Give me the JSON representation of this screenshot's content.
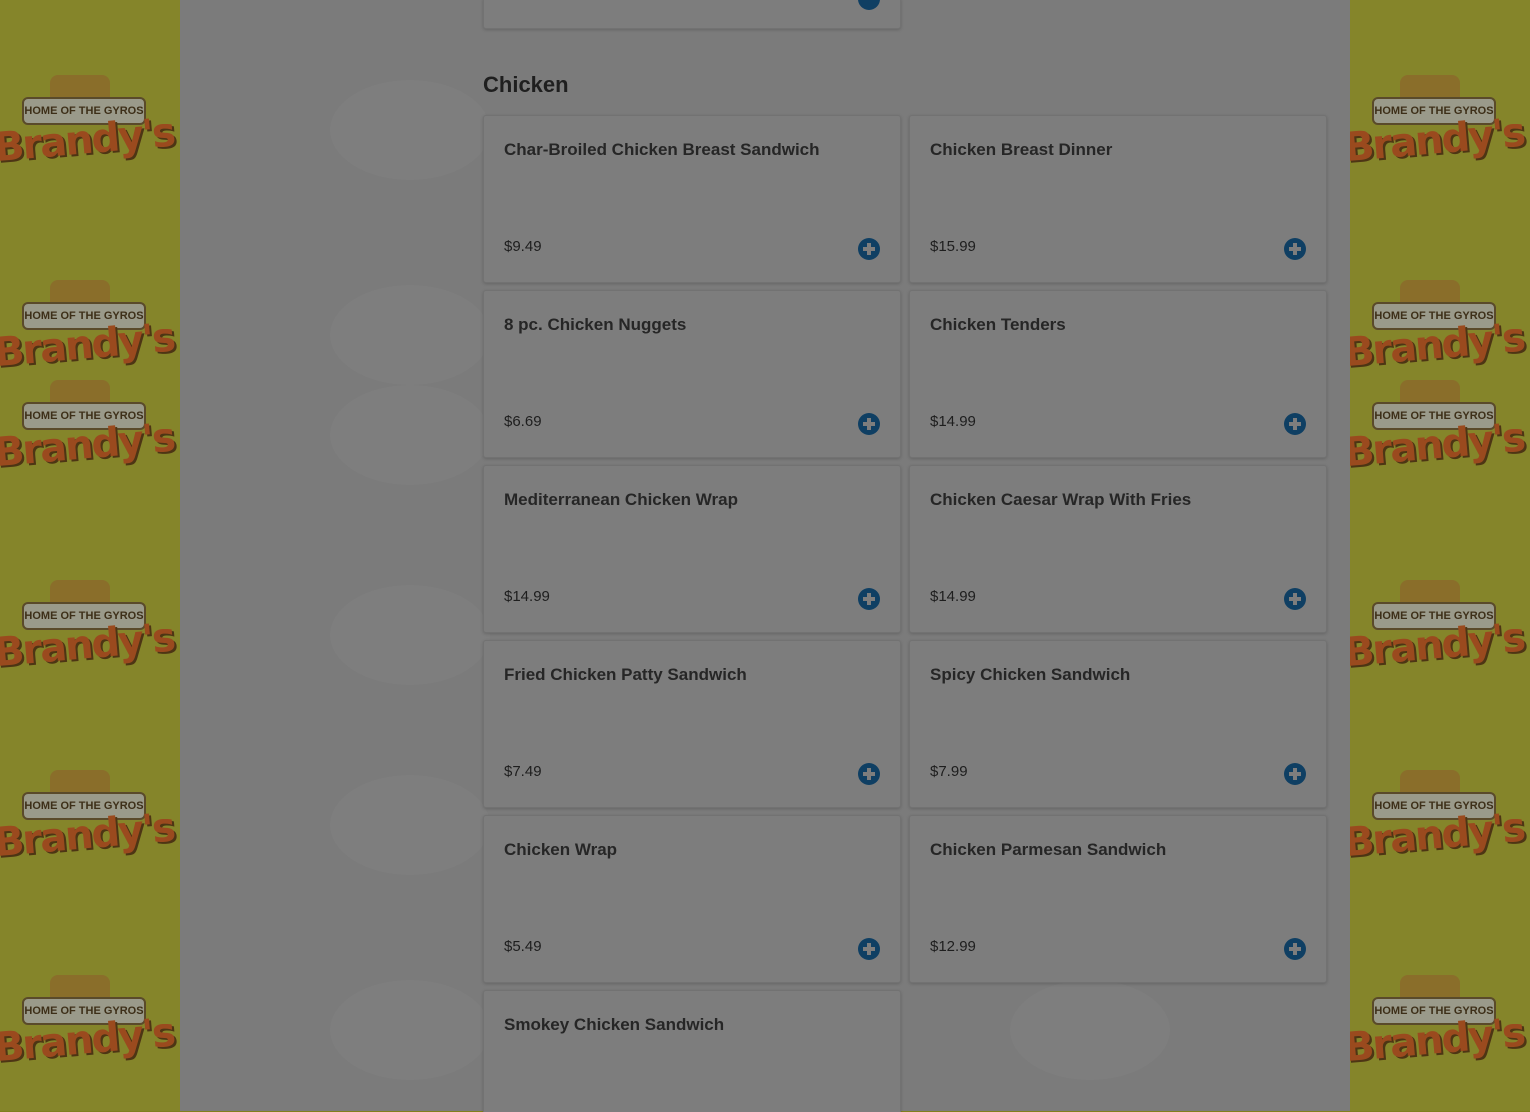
{
  "section": {
    "title": "Chicken"
  },
  "branding": {
    "tagline": "HOME OF THE GYROS",
    "name": "Brandy's"
  },
  "colors": {
    "accent": "#0f3f63",
    "overlay": "#7b7b7b",
    "side": "#85852a"
  },
  "menu_items": [
    {
      "name": "Char-Broiled Chicken Breast Sandwich",
      "price": "$9.49"
    },
    {
      "name": "Chicken Breast Dinner",
      "price": "$15.99"
    },
    {
      "name": "8 pc. Chicken Nuggets",
      "price": "$6.69"
    },
    {
      "name": "Chicken Tenders",
      "price": "$14.99"
    },
    {
      "name": "Mediterranean Chicken Wrap",
      "price": "$14.99"
    },
    {
      "name": "Chicken Caesar Wrap With Fries",
      "price": "$14.99"
    },
    {
      "name": "Fried Chicken Patty Sandwich",
      "price": "$7.49"
    },
    {
      "name": "Spicy Chicken Sandwich",
      "price": "$7.99"
    },
    {
      "name": "Chicken Wrap",
      "price": "$5.49"
    },
    {
      "name": "Chicken Parmesan Sandwich",
      "price": "$12.99"
    },
    {
      "name": "Smokey Chicken Sandwich",
      "price": ""
    }
  ],
  "icons": {
    "add": "plus-circle-icon"
  }
}
